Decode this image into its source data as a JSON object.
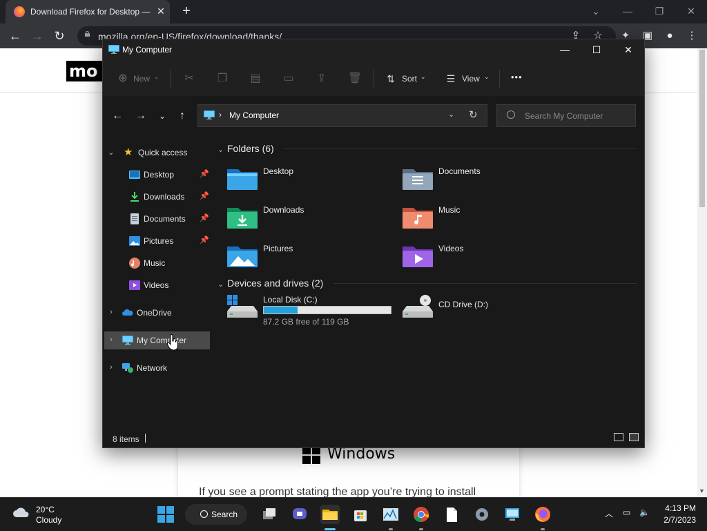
{
  "browser": {
    "tab_title": "Download Firefox for Desktop —",
    "tab_close": "✕",
    "new_tab": "+",
    "url": "mozilla.org/en-US/firefox/download/thanks/",
    "back": "←",
    "forward": "→",
    "reload": "↻"
  },
  "page": {
    "logo_text": "mo",
    "windows_label": "Windows",
    "prompt_text": "If you see a prompt stating the app you’re trying to install"
  },
  "explorer": {
    "title": "My Computer",
    "toolbar": {
      "new_label": "New",
      "sort_label": "Sort",
      "view_label": "View",
      "more_label": "•••"
    },
    "address": {
      "path_label": "My Computer",
      "search_placeholder": "Search My Computer"
    },
    "nav": {
      "quick_access": "Quick access",
      "desktop": "Desktop",
      "downloads": "Downloads",
      "documents": "Documents",
      "pictures": "Pictures",
      "music": "Music",
      "videos": "Videos",
      "onedrive": "OneDrive",
      "my_computer": "My Computer",
      "network": "Network"
    },
    "folders_header": "Folders (6)",
    "folders": [
      {
        "name": "Desktop",
        "icon": "desktop-folder-icon"
      },
      {
        "name": "Documents",
        "icon": "documents-folder-icon"
      },
      {
        "name": "Downloads",
        "icon": "downloads-folder-icon"
      },
      {
        "name": "Music",
        "icon": "music-folder-icon"
      },
      {
        "name": "Pictures",
        "icon": "pictures-folder-icon"
      },
      {
        "name": "Videos",
        "icon": "videos-folder-icon"
      }
    ],
    "drives_header": "Devices and drives (2)",
    "drives": [
      {
        "name": "Local Disk (C:)",
        "free_text": "87.2 GB free of 119 GB",
        "used_fraction": 0.267
      },
      {
        "name": "CD Drive (D:)"
      }
    ],
    "status": {
      "items_count": "8 items"
    }
  },
  "taskbar": {
    "temperature": "20°C",
    "condition": "Cloudy",
    "search_label": "Search",
    "time": "4:13 PM",
    "date": "2/7/2023"
  },
  "colors": {
    "explorer_bg": "#191919",
    "accent": "#26a0da",
    "selection": "#4a4a4a"
  }
}
